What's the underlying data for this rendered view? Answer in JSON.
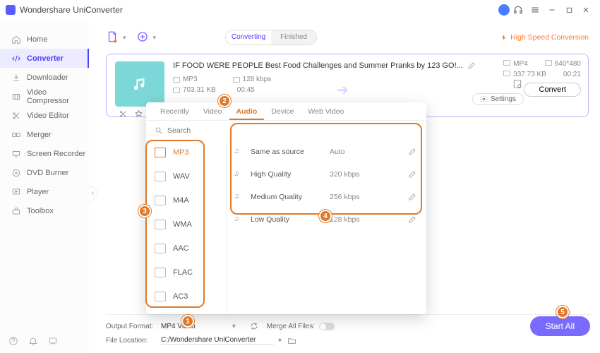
{
  "app_title": "Wondershare UniConverter",
  "sidebar": {
    "items": [
      {
        "label": "Home"
      },
      {
        "label": "Converter"
      },
      {
        "label": "Downloader"
      },
      {
        "label": "Video Compressor"
      },
      {
        "label": "Video Editor"
      },
      {
        "label": "Merger"
      },
      {
        "label": "Screen Recorder"
      },
      {
        "label": "DVD Burner"
      },
      {
        "label": "Player"
      },
      {
        "label": "Toolbox"
      }
    ]
  },
  "tabs": {
    "converting": "Converting",
    "finished": "Finished"
  },
  "hsc_label": "High Speed Conversion",
  "file": {
    "title": "IF FOOD WERE PEOPLE   Best Food Challenges and Summer Pranks by 123 GO!...",
    "src_fmt": "MP3",
    "src_br": "128 kbps",
    "src_size": "703.31 KB",
    "src_dur": "00:45",
    "dst_fmt": "MP4",
    "dst_res": "640*480",
    "dst_size": "337.73 KB",
    "dst_dur": "00:21",
    "convert_btn": "Convert"
  },
  "settings_btn": "Settings",
  "popover": {
    "tabs": [
      "Recently",
      "Video",
      "Audio",
      "Device",
      "Web Video"
    ],
    "search_ph": "Search",
    "formats": [
      "MP3",
      "WAV",
      "M4A",
      "WMA",
      "AAC",
      "FLAC",
      "AC3"
    ],
    "qualities": [
      {
        "name": "Same as source",
        "value": "Auto"
      },
      {
        "name": "High Quality",
        "value": "320 kbps"
      },
      {
        "name": "Medium Quality",
        "value": "256 kbps"
      },
      {
        "name": "Low Quality",
        "value": "128 kbps"
      }
    ]
  },
  "footer": {
    "out_lbl": "Output Format:",
    "out_val": "MP4 Video",
    "merge_lbl": "Merge All Files:",
    "loc_lbl": "File Location:",
    "loc_val": "C:/Wondershare UniConverter"
  },
  "start_all": "Start All",
  "badges": {
    "b1": "1",
    "b2": "2",
    "b3": "3",
    "b4": "4",
    "b5": "5"
  }
}
